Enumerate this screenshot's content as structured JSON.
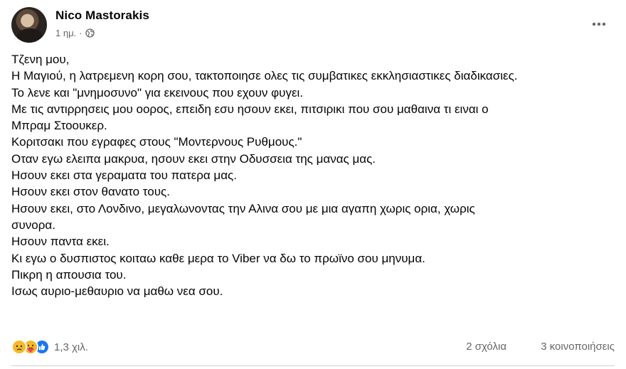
{
  "post": {
    "author": "Nico Mastorakis",
    "time": "1 ημ.",
    "separator": "·",
    "privacy_icon": "globe-icon",
    "more_icon": "more-horizontal-icon",
    "lines": [
      "Τζενη μου,",
      "Η Μαγιού, η λατρεμενη κορη σου, τακτοποιησε ολες τις συμβατικες εκκλησιαστικες διαδικασιες.",
      "Το λενε και \"μνημοσυνο\" για εκεινους που εχουν φυγει.",
      "Με τις αντιρρησεις μου οορος, επειδη εσυ ησουν εκει, πιτσιρικι που σου μαθαινα τι ειναι ο",
      "Μπραμ Στοουκερ.",
      "Κοριτσακι που εγραφες στους \"Μοντερνους Ρυθμους.\"",
      "Οταν εγω ελειπα μακρυα, ησουν εκει στην Οδυσσεια της μανας μας.",
      "Ησουν εκει στα γεραματα του πατερα μας.",
      "Ησουν εκει στον θανατο τους.",
      "Ησουν εκει, στο Λονδινο, μεγαλωνοντας την Αλινα σου με μια αγαπη χωρις ορια, χωρις",
      "συνορα.",
      "Ησουν παντα εκει.",
      "Κι εγω ο δυσπιστος κοιταω καθε μερα το Viber να δω το πρωϊνο σου μηνυμα.",
      "Πικρη η απουσια του.",
      "Ισως αυριο-μεθαυριο να μαθω νεα σου."
    ]
  },
  "footer": {
    "reactions": [
      "sad-reaction-icon",
      "care-reaction-icon",
      "like-reaction-icon"
    ],
    "reaction_count": "1,3 χιλ.",
    "comments": "2 σχόλια",
    "shares": "3 κοινοποιήσεις"
  },
  "colors": {
    "text": "#050505",
    "secondary": "#65676b",
    "like_blue": "#1877f2",
    "reaction_yellow": "#f7b928"
  }
}
